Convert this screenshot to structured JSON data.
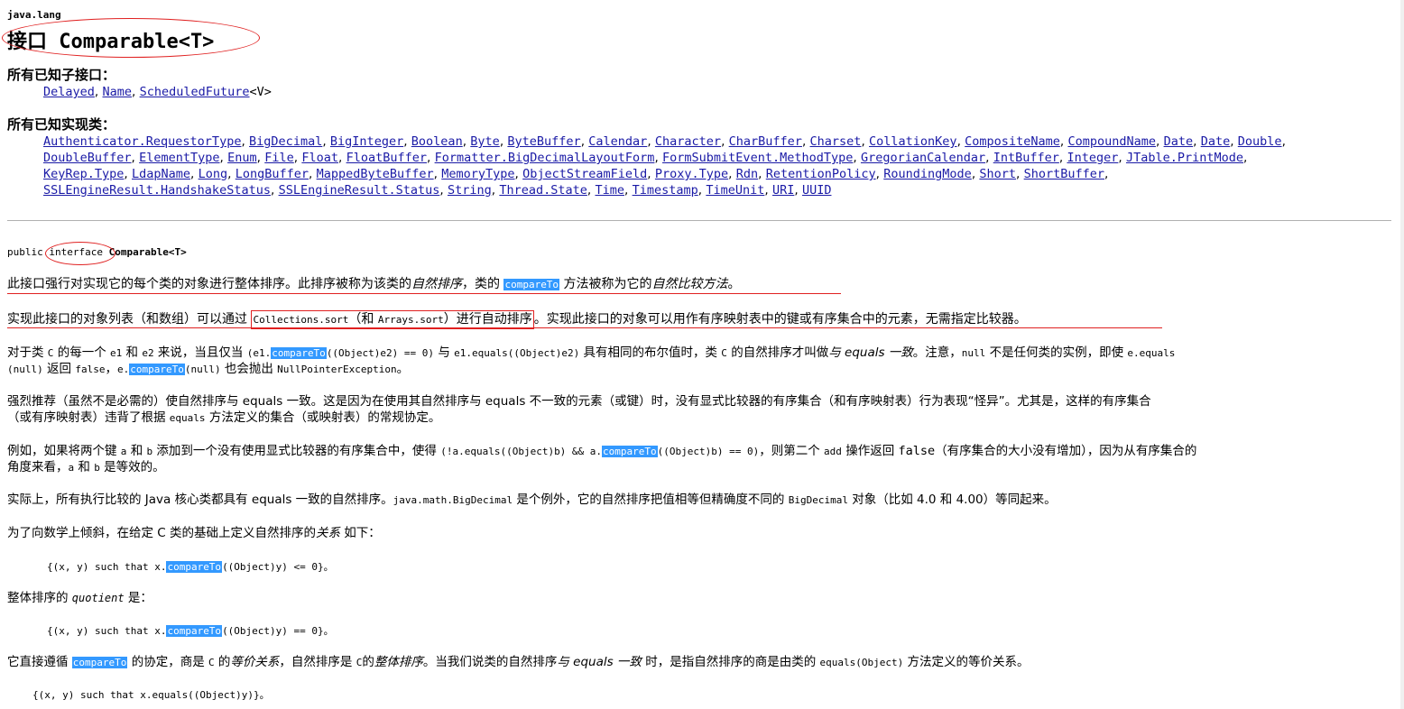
{
  "package": "java.lang",
  "title": "接口 Comparable<T>",
  "subinterfaces": {
    "label": "所有已知子接口：",
    "items": [
      "Delayed",
      "Name",
      "ScheduledFuture"
    ],
    "suffix": "<V>"
  },
  "implementing_classes": {
    "label": "所有已知实现类：",
    "rows": [
      [
        "Authenticator.RequestorType",
        "BigDecimal",
        "BigInteger",
        "Boolean",
        "Byte",
        "ByteBuffer",
        "Calendar",
        "Character",
        "CharBuffer",
        "Charset",
        "CollationKey",
        "CompositeName",
        "CompoundName",
        "Date",
        "Date",
        "Double"
      ],
      [
        "DoubleBuffer",
        "ElementType",
        "Enum",
        "File",
        "Float",
        "FloatBuffer",
        "Formatter.BigDecimalLayoutForm",
        "FormSubmitEvent.MethodType",
        "GregorianCalendar",
        "IntBuffer",
        "Integer",
        "JTable.PrintMode"
      ],
      [
        "KeyRep.Type",
        "LdapName",
        "Long",
        "LongBuffer",
        "MappedByteBuffer",
        "MemoryType",
        "ObjectStreamField",
        "Proxy.Type",
        "Rdn",
        "RetentionPolicy",
        "RoundingMode",
        "Short",
        "ShortBuffer"
      ],
      [
        "SSLEngineResult.HandshakeStatus",
        "SSLEngineResult.Status",
        "String",
        "Thread.State",
        "Time",
        "Timestamp",
        "TimeUnit",
        "URI",
        "UUID"
      ]
    ]
  },
  "declaration": {
    "public": "public",
    "interface": "interface",
    "name": "Comparable<T>"
  },
  "paragraphs": {
    "p1_a": "此接口强行对实现它的每个类的对象进行整体排序。此排序被称为该类的",
    "p1_em1": "自然排序",
    "p1_b": "，类的 ",
    "p1_hl": "compareTo",
    "p1_c": " 方法被称为它的",
    "p1_em2": "自然比较方法",
    "p1_d": "。",
    "p2_a": "实现此接口的对象列表（和数组）可以通过 ",
    "p2_code1": "Collections.sort",
    "p2_b": "（和 ",
    "p2_code2": "Arrays.sort",
    "p2_c": "）进行自动排序",
    "p2_d": "。实现此接口的对象可以用作有序映射表中的键或有序集合中的元素，无需指定比较器。",
    "p3_line1_a": "对于类 ",
    "p3_c": "C",
    "p3_line1_b": " 的每一个 ",
    "p3_e1": "e1",
    "p3_and": " 和 ",
    "p3_e2": "e2",
    "p3_line1_c": " 来说，当且仅当 ",
    "p3_code_a": "(e1.",
    "p3_hl": "compareTo",
    "p3_code_b": "((Object)e2) == 0)",
    "p3_with": " 与 ",
    "p3_code_c": "e1.equals((Object)e2)",
    "p3_line1_d": " 具有相同的布尔值时，类 ",
    "p3_c2": "C",
    "p3_line1_e": " 的自然排序才叫做",
    "p3_em": "与 equals 一致",
    "p3_line1_f": "。注意，",
    "p3_null": "null",
    "p3_line1_g": " 不是任何类的实例，即使 ",
    "p3_code_d": "e.equals",
    "p3_line2_a": "(null)",
    "p3_line2_b": " 返回 ",
    "p3_false": "false",
    "p3_line2_c": "，",
    "p3_code_e": "e.",
    "p3_hl2": "compareTo",
    "p3_code_f": "(null)",
    "p3_line2_d": " 也会抛出 ",
    "p3_npe": "NullPointerException",
    "p3_line2_e": "。",
    "p4_line1": "强烈推荐（虽然不是必需的）使自然排序与 equals 一致。这是因为在使用其自然排序与 equals 不一致的元素（或键）时，没有显式比较器的有序集合（和有序映射表）行为表现“怪异”。尤其是，这样的有序集合",
    "p4_line2_a": "（或有序映射表）违背了根据 ",
    "p4_equals": "equals",
    "p4_line2_b": " 方法定义的集合（或映射表）的常规协定。",
    "p5_line1_a": "例如，如果将两个键 ",
    "p5_a": "a",
    "p5_and": " 和 ",
    "p5_b": "b",
    "p5_line1_b": " 添加到一个没有使用显式比较器的有序集合中，使得 ",
    "p5_code_a": "(!a.equals((Object)b) && a.",
    "p5_hl": "compareTo",
    "p5_code_b": "((Object)b) == 0)",
    "p5_line1_c": "，则第二个 ",
    "p5_add": "add",
    "p5_line1_d": " 操作返回 ",
    "p5_false": "false",
    "p5_line1_e": "（有序集合的大小没有增加），因为从有序集合的",
    "p5_line2_a": "角度来看，",
    "p5_a2": "a",
    "p5_and2": " 和 ",
    "p5_b2": "b",
    "p5_line2_b": " 是等效的。",
    "p6_a": "实际上，所有执行比较的 Java 核心类都具有 equals 一致的自然排序。",
    "p6_code1": "java.math.BigDecimal",
    "p6_b": " 是个例外，它的自然排序把值相等但精确度不同的 ",
    "p6_code2": "BigDecimal",
    "p6_c": " 对象（比如 4.0 和 4.00）等同起来。",
    "p7_a": "为了向数学上倾斜，在给定 C 类的基础上定义自然排序的",
    "p7_em": "关系",
    "p7_b": " 如下：",
    "code1_a": "{(x, y) such that x.",
    "code1_hl": "compareTo",
    "code1_b": "((Object)y) <= 0}。",
    "p8_a": "整体排序的 ",
    "p8_em": "quotient",
    "p8_b": " 是：",
    "code2_a": "{(x, y) such that x.",
    "code2_hl": "compareTo",
    "code2_b": "((Object)y) == 0}。",
    "p9_a": "它直接遵循 ",
    "p9_hl": "compareTo",
    "p9_b": " 的协定，商是 ",
    "p9_c": "C",
    "p9_d": " 的",
    "p9_em1": "等价关系",
    "p9_e": "，自然排序是 ",
    "p9_c2": "C",
    "p9_f": "的",
    "p9_em2": "整体排序",
    "p9_g": "。当我们说类的自然排序",
    "p9_em3": "与 equals 一致",
    "p9_h": " 时，是指自然排序的商是由类的 ",
    "p9_code": "equals(Object)",
    "p9_i": " 方法定义的等价关系。",
    "code3": "{(x, y) such that x.equals((Object)y)}。"
  },
  "colors": {
    "link": "#1a1aa6",
    "highlight": "#3399ff",
    "annotation": "#e02020"
  }
}
